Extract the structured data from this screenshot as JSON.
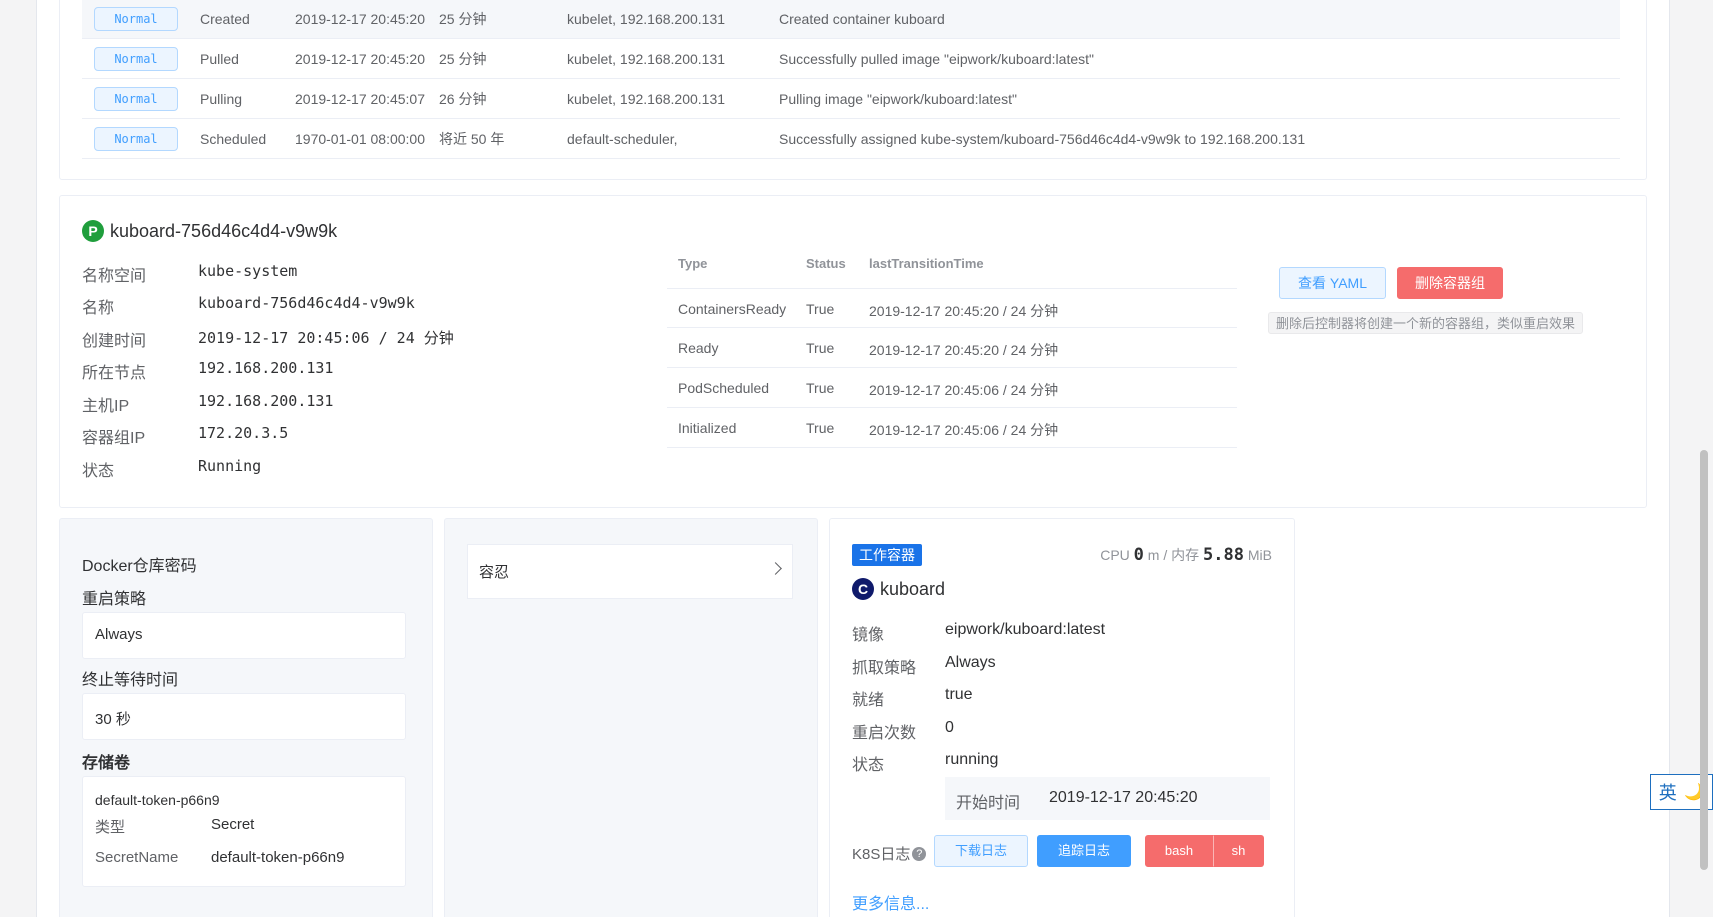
{
  "events": [
    {
      "type": "Normal",
      "reason": "Created",
      "time": "2019-12-17 20:45:20",
      "age": "25 分钟",
      "source": "kubelet, 192.168.200.131",
      "message": "Created container kuboard"
    },
    {
      "type": "Normal",
      "reason": "Pulled",
      "time": "2019-12-17 20:45:20",
      "age": "25 分钟",
      "source": "kubelet, 192.168.200.131",
      "message": "Successfully pulled image \"eipwork/kuboard:latest\""
    },
    {
      "type": "Normal",
      "reason": "Pulling",
      "time": "2019-12-17 20:45:07",
      "age": "26 分钟",
      "source": "kubelet, 192.168.200.131",
      "message": "Pulling image \"eipwork/kuboard:latest\""
    },
    {
      "type": "Normal",
      "reason": "Scheduled",
      "time": "1970-01-01 08:00:00",
      "age": "将近 50 年",
      "source": "default-scheduler,",
      "message": "Successfully assigned kube-system/kuboard-756d46c4d4-v9w9k to 192.168.200.131"
    }
  ],
  "pod": {
    "badge": "P",
    "name": "kuboard-756d46c4d4-v9w9k",
    "fields": [
      {
        "label": "名称空间",
        "value": "kube-system"
      },
      {
        "label": "名称",
        "value": "kuboard-756d46c4d4-v9w9k"
      },
      {
        "label": "创建时间",
        "value": "2019-12-17 20:45:06 / 24 分钟"
      },
      {
        "label": "所在节点",
        "value": "192.168.200.131"
      },
      {
        "label": "主机IP",
        "value": "192.168.200.131"
      },
      {
        "label": "容器组IP",
        "value": "172.20.3.5"
      },
      {
        "label": "状态",
        "value": "Running"
      }
    ],
    "conditions_header": {
      "type": "Type",
      "status": "Status",
      "time": "lastTransitionTime"
    },
    "conditions": [
      {
        "type": "ContainersReady",
        "status": "True",
        "time": "2019-12-17 20:45:20 / 24 分钟"
      },
      {
        "type": "Ready",
        "status": "True",
        "time": "2019-12-17 20:45:20 / 24 分钟"
      },
      {
        "type": "PodScheduled",
        "status": "True",
        "time": "2019-12-17 20:45:06 / 24 分钟"
      },
      {
        "type": "Initialized",
        "status": "True",
        "time": "2019-12-17 20:45:06 / 24 分钟"
      }
    ],
    "view_yaml": "查看 YAML",
    "delete_pod": "删除容器组",
    "delete_hint": "删除后控制器将创建一个新的容器组，类似重启效果"
  },
  "left": {
    "docker_secret": "Docker仓库密码",
    "restart_label": "重启策略",
    "restart_value": "Always",
    "grace_label": "终止等待时间",
    "grace_value": "30 秒",
    "volumes_label": "存储卷",
    "volume_name": "default-token-p66n9",
    "volume_type_label": "类型",
    "volume_type": "Secret",
    "secret_name_label": "SecretName",
    "secret_name": "default-token-p66n9"
  },
  "middle": {
    "tolerations": "容忍"
  },
  "container": {
    "tag": "工作容器",
    "cpu_label": "CPU",
    "cpu_value": "0",
    "cpu_unit": "m / 内存",
    "mem_value": "5.88",
    "mem_unit": "MiB",
    "badge": "C",
    "name": "kuboard",
    "fields": [
      {
        "label": "镜像",
        "value": "eipwork/kuboard:latest"
      },
      {
        "label": "抓取策略",
        "value": "Always"
      },
      {
        "label": "就绪",
        "value": "true"
      },
      {
        "label": "重启次数",
        "value": "0"
      },
      {
        "label": "状态",
        "value": "running"
      }
    ],
    "start_label": "开始时间",
    "start_value": "2019-12-17 20:45:20",
    "logs_label": "K8S日志",
    "download_logs": "下载日志",
    "follow_logs": "追踪日志",
    "bash": "bash",
    "sh": "sh",
    "more_info": "更多信息..."
  },
  "ime": {
    "lang": "英",
    "moon": "🌙"
  },
  "colors": {
    "primary": "#409eff",
    "danger": "#f56c6c",
    "pod_badge": "#1f9e3c",
    "container_badge": "#0f1a6b"
  }
}
